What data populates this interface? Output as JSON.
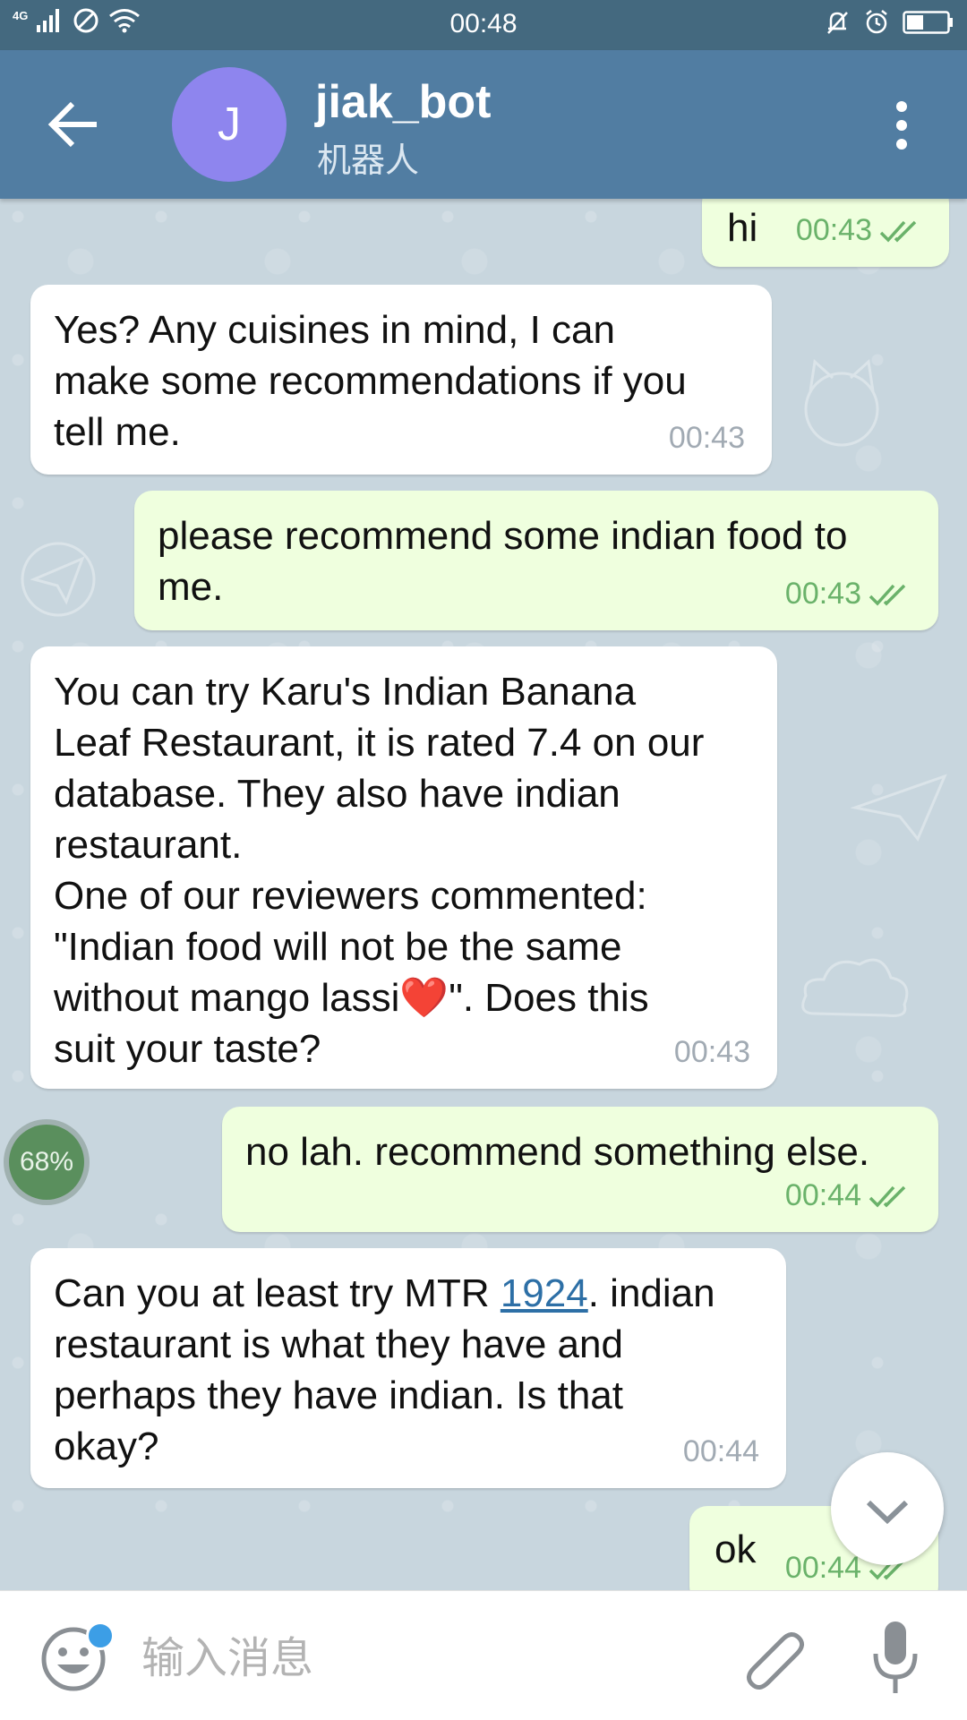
{
  "status_bar": {
    "network": "4G",
    "time": "00:48"
  },
  "header": {
    "avatar_letter": "J",
    "title": "jiak_bot",
    "subtitle": "机器人"
  },
  "messages": [
    {
      "from": "me",
      "text": "hi",
      "time": "00:43",
      "status": "read"
    },
    {
      "from": "bot",
      "text": "Yes? Any cuisines in mind, I can\nmake some recommendations if you\ntell me.",
      "time": "00:43"
    },
    {
      "from": "me",
      "text": "please recommend some indian food to\nme.",
      "time": "00:43",
      "status": "read"
    },
    {
      "from": "bot",
      "text": "You can try Karu's Indian Banana\nLeaf Restaurant, it is rated 7.4 on our\ndatabase. They also have indian\nrestaurant.\nOne of our reviewers commented:\n\"Indian food will not be the same\nwithout mango lassi❤️\". Does this\nsuit your taste?",
      "time": "00:43"
    },
    {
      "from": "me",
      "text": "no lah. recommend something else.",
      "time": "00:44",
      "status": "read"
    },
    {
      "from": "bot",
      "text_before": "Can you at least try MTR ",
      "link": "1924",
      "text_after": ". indian\nrestaurant is what they have and\nperhaps they have indian. Is that\nokay?",
      "time": "00:44"
    },
    {
      "from": "me",
      "text": "ok",
      "time": "00:44",
      "status": "read"
    }
  ],
  "upload_progress": "68%",
  "input": {
    "placeholder": "输入消息",
    "value": ""
  },
  "colors": {
    "status_bar": "#44697f",
    "toolbar": "#517da2",
    "avatar": "#8e85ee",
    "outgoing_bubble": "#efffde",
    "incoming_bubble": "#ffffff",
    "read_check": "#6ab26a"
  },
  "icons": [
    "back-arrow-icon",
    "more-vert-icon",
    "double-check-icon",
    "chevron-down-icon",
    "emoji-icon",
    "attach-icon",
    "mic-icon",
    "signal-icon",
    "dnd-icon",
    "wifi-icon",
    "bell-off-icon",
    "alarm-icon",
    "battery-icon"
  ]
}
